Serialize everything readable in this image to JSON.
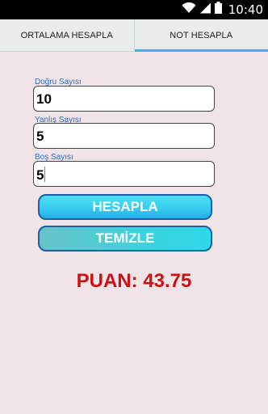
{
  "status_bar": {
    "time": "10:40",
    "icons": [
      "wifi-icon",
      "signal-icon",
      "battery-icon"
    ]
  },
  "tabs": [
    {
      "label": "ORTALAMA HESAPLA",
      "active": false
    },
    {
      "label": "NOT HESAPLA",
      "active": true
    }
  ],
  "form": {
    "correct": {
      "label": "Doğru Sayısı",
      "value": "10"
    },
    "wrong": {
      "label": "Yanlış Sayısı",
      "value": "5"
    },
    "empty": {
      "label": "Boş Sayısı",
      "value": "5"
    }
  },
  "buttons": {
    "calculate": "HESAPLA",
    "clear": "TEMİZLE"
  },
  "result": "PUAN: 43.75",
  "colors": {
    "accent": "#33b5e5",
    "label_blue": "#2a6ebd",
    "result_red": "#cc1111",
    "background": "#f0e4e8"
  }
}
